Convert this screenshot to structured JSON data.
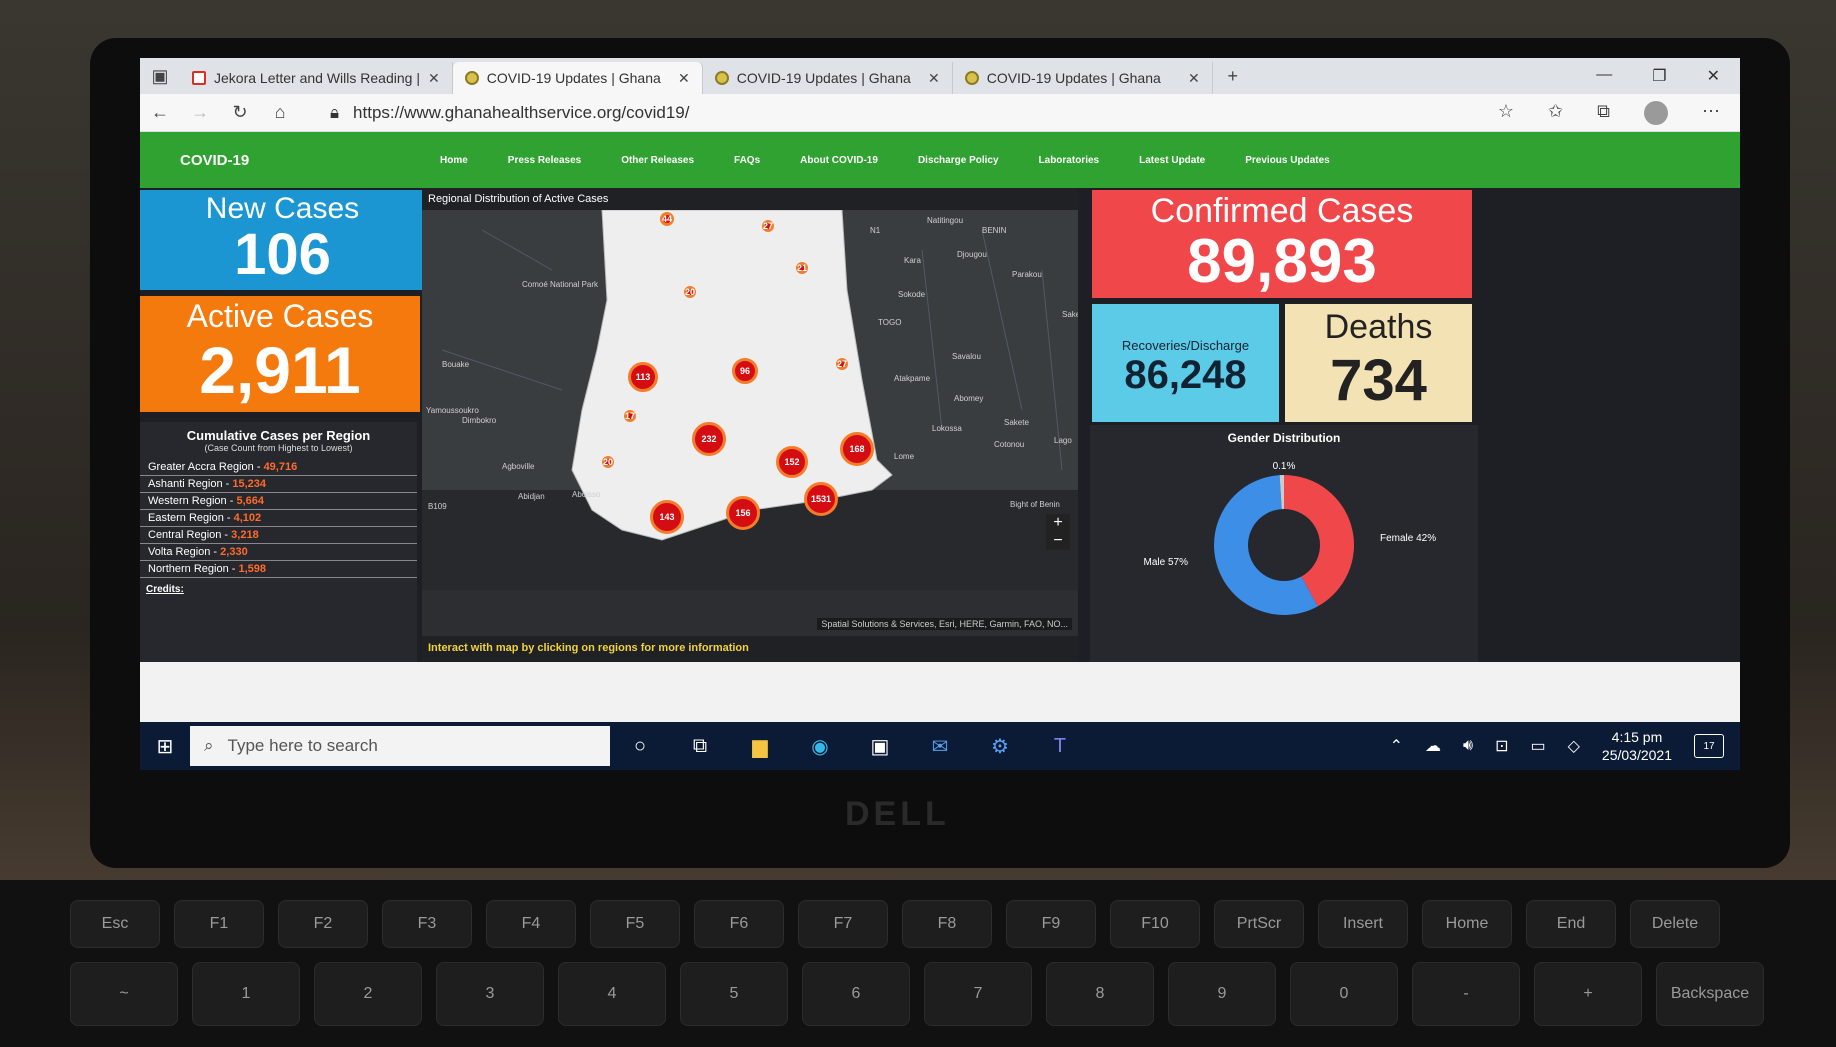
{
  "browser": {
    "tabs": [
      {
        "label": "Jekora Letter and Wills Reading |",
        "icon": "gmail-icon"
      },
      {
        "label": "COVID-19 Updates | Ghana",
        "icon": "ghs-icon"
      },
      {
        "label": "COVID-19 Updates | Ghana",
        "icon": "ghs-icon"
      },
      {
        "label": "COVID-19 Updates | Ghana",
        "icon": "ghs-icon"
      }
    ],
    "url": "https://www.ghanahealthservice.org/covid19/"
  },
  "site": {
    "brand": "COVID-19",
    "nav": [
      "Home",
      "Press Releases",
      "Other Releases",
      "FAQs",
      "About COVID-19",
      "Discharge Policy",
      "Laboratories",
      "Latest Update",
      "Previous Updates"
    ],
    "new_cases": {
      "label": "New Cases",
      "value": "106",
      "color": "#1b96d3"
    },
    "active_cases": {
      "label": "Active Cases",
      "value": "2,911",
      "color": "#f47a0e"
    },
    "confirmed": {
      "label": "Confirmed Cases",
      "value": "89,893",
      "color": "#f0474a"
    },
    "recoveries": {
      "label": "Recoveries/Discharge",
      "value": "86,248",
      "color": "#5ccbe8"
    },
    "deaths": {
      "label": "Deaths",
      "value": "734",
      "color": "#f3e2b4"
    },
    "regions": {
      "title": "Cumulative Cases per Region",
      "subtitle": "(Case Count from Highest to Lowest)",
      "rows": [
        {
          "name": "Greater Accra Region - ",
          "value": "49,716"
        },
        {
          "name": "Ashanti Region - ",
          "value": "15,234"
        },
        {
          "name": "Western Region - ",
          "value": "5,664"
        },
        {
          "name": "Eastern Region - ",
          "value": "4,102"
        },
        {
          "name": "Central Region - ",
          "value": "3,218"
        },
        {
          "name": "Volta Region - ",
          "value": "2,330"
        },
        {
          "name": "Northern Region - ",
          "value": "1,598"
        }
      ],
      "credits": "Credits:"
    },
    "map": {
      "title": "Regional Distribution of Active Cases",
      "footer": "Interact with map by clicking on regions for more information",
      "attribution": "Spatial Solutions & Services, Esri, HERE, Garmin, FAO, NO...",
      "clusters": [
        "44",
        "27",
        "21",
        "20",
        "113",
        "96",
        "27",
        "17",
        "232",
        "152",
        "168",
        "20",
        "1531",
        "156",
        "143"
      ],
      "places": [
        "Natitingou",
        "BENIN",
        "Djougou",
        "Kara",
        "Parakou",
        "Sokode",
        "TOGO",
        "Sake",
        "Savalou",
        "Atakpame",
        "Abomey",
        "Lokossa",
        "Sakete",
        "Cotonou",
        "Lago",
        "Lome",
        "Bight of Benin",
        "Comoé National Park",
        "Bouake",
        "Yamoussoukro",
        "Dimbokro",
        "Agboville",
        "Abidjan",
        "Aboisso",
        "N1",
        "B109"
      ]
    },
    "gender": {
      "title": "Gender Distribution",
      "female_label": "Female 42%",
      "male_label": "Male 57%",
      "other_label": "0.1%"
    }
  },
  "chart_data": {
    "type": "pie",
    "title": "Gender Distribution",
    "categories": [
      "Female",
      "Male",
      "Other"
    ],
    "values": [
      42,
      57,
      1
    ],
    "colors": [
      "#f0474a",
      "#3c8ee6",
      "#cccccc"
    ]
  },
  "taskbar": {
    "search_placeholder": "Type here to search",
    "time": "4:15 pm",
    "date": "25/03/2021",
    "notifications": "17"
  },
  "device": {
    "brand": "DELL"
  }
}
